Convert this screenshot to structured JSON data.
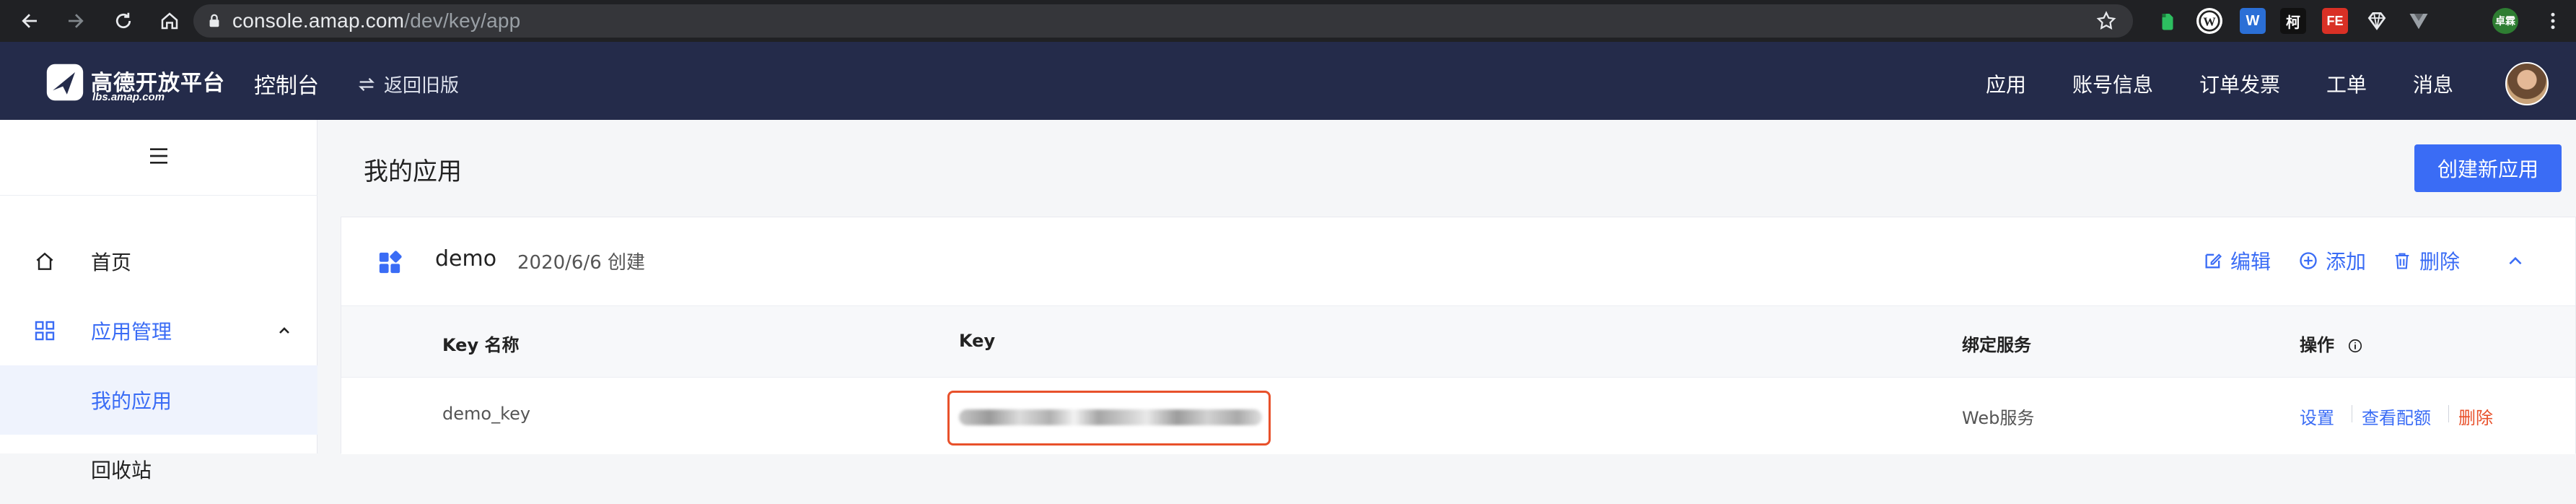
{
  "browser": {
    "url_host": "console.amap.com",
    "url_path": "/dev/key/app",
    "extensions": [
      "W",
      "柯",
      "FE"
    ]
  },
  "brand": {
    "title": "高德开放平台",
    "subtitle": "lbs.amap.com",
    "console": "控制台",
    "back_old": "返回旧版"
  },
  "topnav": [
    "应用",
    "账号信息",
    "订单发票",
    "工单",
    "消息"
  ],
  "sidebar": {
    "items": [
      {
        "label": "首页"
      },
      {
        "label": "应用管理"
      },
      {
        "label": "我的应用"
      },
      {
        "label": "回收站"
      }
    ]
  },
  "main": {
    "title": "我的应用",
    "create_button": "创建新应用",
    "app": {
      "name": "demo",
      "created": "2020/6/6 创建",
      "actions": {
        "edit": "编辑",
        "add": "添加",
        "delete": "删除"
      }
    },
    "table": {
      "headers": {
        "key_name": "Key 名称",
        "key": "Key",
        "service": "绑定服务",
        "ops": "操作"
      },
      "rows": [
        {
          "key_name": "demo_key",
          "service": "Web服务",
          "op_settings": "设置",
          "op_quota": "查看配额",
          "op_delete": "删除"
        }
      ]
    }
  },
  "colors": {
    "accent": "#3a6cf5",
    "header_bg": "#242b4a",
    "danger": "#e8512b"
  }
}
